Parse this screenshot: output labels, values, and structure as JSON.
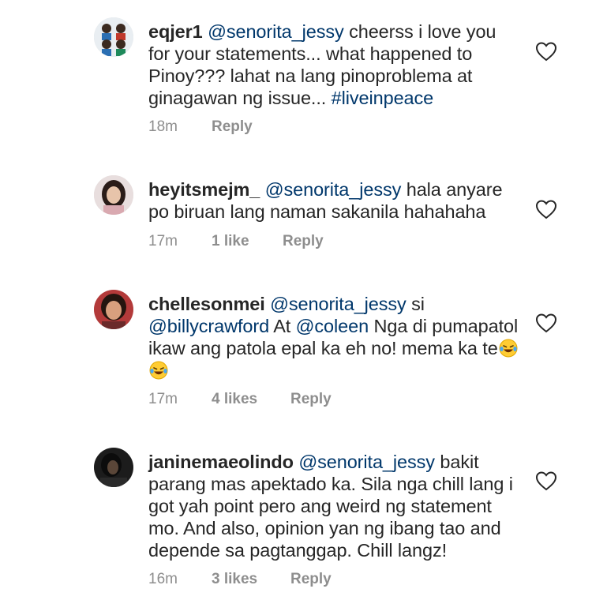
{
  "comments": [
    {
      "username": "eqjer1",
      "mention": "@senorita_jessy",
      "text": "cheerss i love you for your statements... what happened to Pinoy??? lahat na lang pinoproblema at ginagawan ng issue...",
      "hashtag": "#liveinpeace",
      "time": "18m",
      "likes": "",
      "reply": "Reply"
    },
    {
      "username": "heyitsmejm_",
      "mention": "@senorita_jessy",
      "text": "hala anyare po biruan lang naman sakanila hahahaha",
      "time": "17m",
      "likes": "1 like",
      "reply": "Reply"
    },
    {
      "username": "chellesonmei",
      "mention": "@senorita_jessy",
      "text_a": "si",
      "mention_2": "@billycrawford",
      "text_b": "At",
      "mention_3": "@coleen",
      "text_c": "Nga di pumapatol ikaw ang patola epal ka eh no! mema ka te",
      "time": "17m",
      "likes": "4 likes",
      "reply": "Reply"
    },
    {
      "username": "janinemaeolindo",
      "mention": "@senorita_jessy",
      "text": "bakit parang mas apektado ka. Sila nga chill lang i got yah point pero ang weird ng statement mo. And also, opinion yan ng ibang tao and depende sa pagtanggap. Chill langz!",
      "time": "16m",
      "likes": "3 likes",
      "reply": "Reply"
    }
  ],
  "icons": {
    "like": "heart-outline-icon",
    "emoji": "laughing-tears-emoji"
  }
}
